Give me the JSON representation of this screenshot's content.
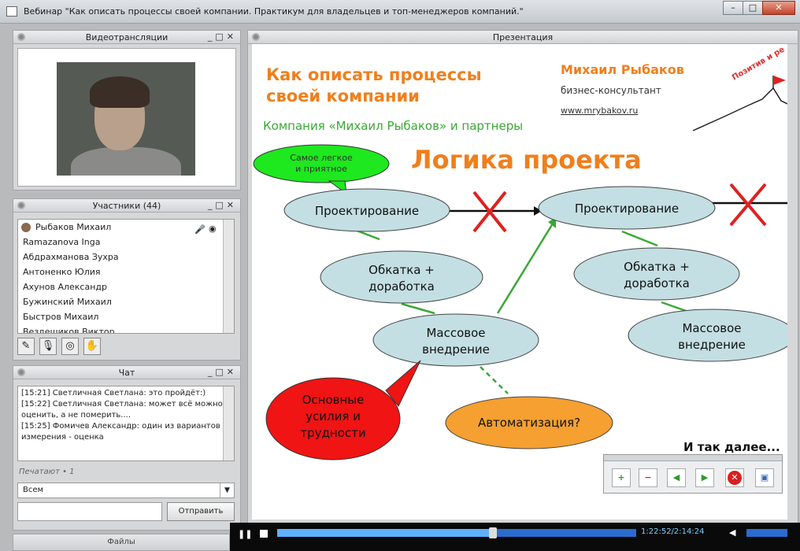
{
  "window": {
    "title": "Вебинар \"Как описать процессы своей компании. Практикум для владельцев и топ-менеджеров компаний.\"",
    "minimize": "–",
    "maximize": "□",
    "close": "✕"
  },
  "video_panel": {
    "title": "Видеотрансляции"
  },
  "participants_panel": {
    "title": "Участники (44)",
    "items": [
      "Рыбаков Михаил",
      "Ramazanova Inga",
      "Абдрахманова Зухра",
      "Антоненко Юлия",
      "Ахунов Александр",
      "Бужинский Михаил",
      "Быстров Михаил",
      "Вездешиков Виктор"
    ]
  },
  "chat_panel": {
    "title": "Чат",
    "messages": [
      "[15:21] Светличная Светлана: это пройдёт:)",
      "[15:22] Светличная Светлана: может всё можно оценить, а не померить....",
      "[15:25] Фомичев Александр: один из вариантов измерения - оценка"
    ],
    "typing": "Печатают • 1",
    "recipient": "Всем",
    "send_label": "Отправить"
  },
  "files_panel": {
    "title": "Файлы"
  },
  "presentation_panel": {
    "title": "Презентация"
  },
  "slide": {
    "heading_line1": "Как описать процессы",
    "heading_line2": "своей компании",
    "author": "Михаил Рыбаков",
    "role": "бизнес-консультант",
    "site": "www.mrybakov.ru",
    "company": "Компания «Михаил Рыбаков» и партнеры",
    "logo_text": "Позитив и ре",
    "main_title": "Логика проекта",
    "bubble_line1": "Самое легкое",
    "bubble_line2": "и приятное",
    "design1": "Проектирование",
    "test1_line1": "Обкатка +",
    "test1_line2": "доработка",
    "mass1_line1": "Массовое",
    "mass1_line2": "внедрение",
    "effort_line1": "Основные",
    "effort_line2": "усилия и",
    "effort_line3": "трудности",
    "automation": "Автоматизация?",
    "design2": "Проектирование",
    "test2_line1": "Обкатка +",
    "test2_line2": "доработка",
    "mass2_line1": "Массовое",
    "mass2_line2": "внедрение",
    "and_so_on": "И так далее..."
  },
  "player": {
    "time": "1:22:52/2:14:24",
    "progress": 0.6
  }
}
